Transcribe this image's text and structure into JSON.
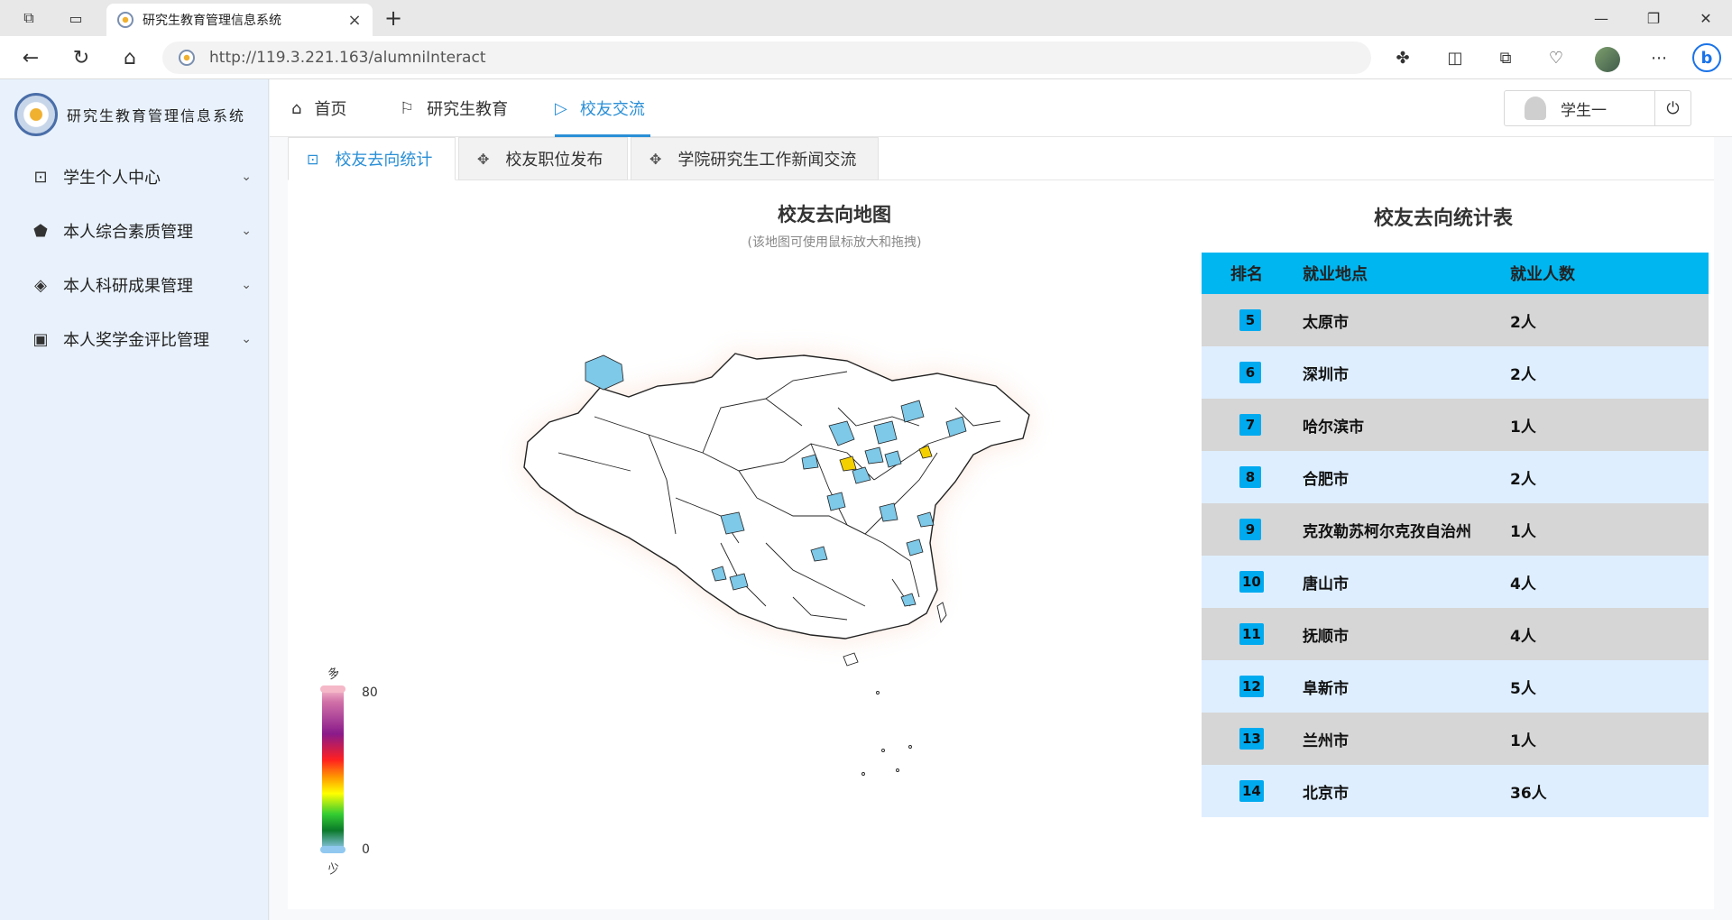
{
  "browser": {
    "tab_title": "研究生教育管理信息系统",
    "url": "http://119.3.221.163/alumniInteract"
  },
  "app": {
    "logo_text": "研究生教育管理信息系统",
    "sidebar": [
      {
        "label": "学生个人中心",
        "icon": "chart-monitor-icon"
      },
      {
        "label": "本人综合素质管理",
        "icon": "pentagon-icon"
      },
      {
        "label": "本人科研成果管理",
        "icon": "layers-icon"
      },
      {
        "label": "本人奖学金评比管理",
        "icon": "certificate-icon"
      }
    ],
    "topnav": [
      {
        "label": "首页",
        "icon": "home-icon"
      },
      {
        "label": "研究生教育",
        "icon": "flag-icon"
      },
      {
        "label": "校友交流",
        "icon": "send-icon",
        "active": true
      }
    ],
    "user": {
      "name": "学生一"
    }
  },
  "subtabs": [
    {
      "label": "校友去向统计",
      "active": true
    },
    {
      "label": "校友职位发布"
    },
    {
      "label": "学院研究生工作新闻交流"
    }
  ],
  "map": {
    "title": "校友去向地图",
    "subtitle": "(该地图可使用鼠标放大和拖拽)",
    "legend": {
      "max": "80",
      "min": "0",
      "high_label": "多",
      "low_label": "少"
    },
    "colors": {
      "low": "#7ec8e8",
      "mid": "#f5d000",
      "border": "#222222",
      "glow": "#f7c8b0"
    }
  },
  "table": {
    "title": "校友去向统计表",
    "headers": [
      "排名",
      "就业地点",
      "就业人数"
    ],
    "rows": [
      {
        "rank": "5",
        "place": "太原市",
        "count": "2人"
      },
      {
        "rank": "6",
        "place": "深圳市",
        "count": "2人"
      },
      {
        "rank": "7",
        "place": "哈尔滨市",
        "count": "1人"
      },
      {
        "rank": "8",
        "place": "合肥市",
        "count": "2人"
      },
      {
        "rank": "9",
        "place": "克孜勒苏柯尔克孜自治州",
        "count": "1人"
      },
      {
        "rank": "10",
        "place": "唐山市",
        "count": "4人"
      },
      {
        "rank": "11",
        "place": "抚顺市",
        "count": "4人"
      },
      {
        "rank": "12",
        "place": "阜新市",
        "count": "5人"
      },
      {
        "rank": "13",
        "place": "兰州市",
        "count": "1人"
      },
      {
        "rank": "14",
        "place": "北京市",
        "count": "36人"
      }
    ]
  }
}
